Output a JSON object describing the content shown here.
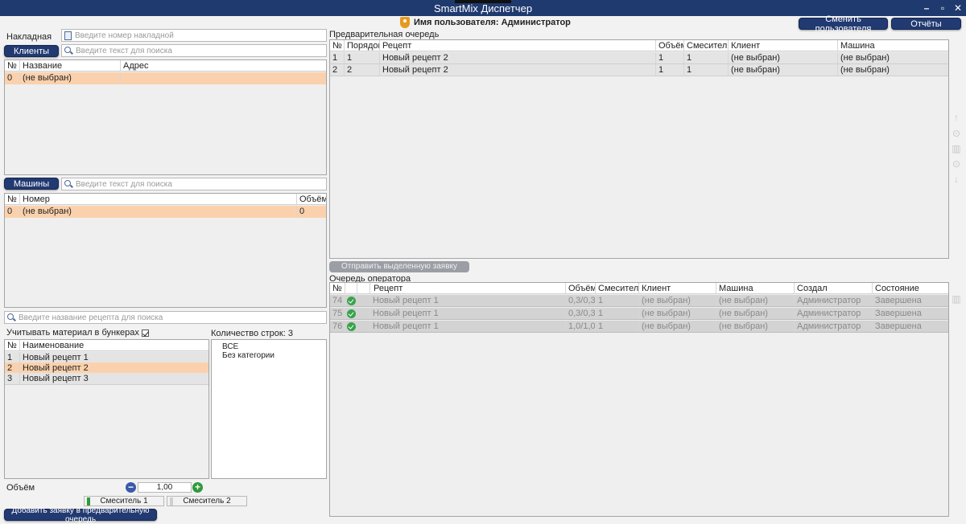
{
  "app": {
    "title": "SmartMix Диспетчер",
    "user_line": "Имя пользователя: Администратор",
    "change_user_label": "Сменить пользователя",
    "reports_label": "Отчёты"
  },
  "invoice": {
    "label": "Накладная",
    "placeholder": "Введите номер накладной"
  },
  "clients": {
    "button_label": "Клиенты",
    "placeholder": "Введите текст для поиска",
    "columns": [
      "№",
      "Название",
      "Адрес"
    ],
    "rows": [
      [
        "0",
        "(не выбран)",
        ""
      ]
    ]
  },
  "machines": {
    "button_label": "Машины",
    "placeholder": "Введите текст для поиска",
    "columns": [
      "№",
      "Номер",
      "Объём"
    ],
    "rows": [
      [
        "0",
        "(не выбран)",
        "0"
      ]
    ]
  },
  "recipes": {
    "placeholder": "Введите название рецепта для поиска",
    "bunker_label": "Учитывать материал в бункерах",
    "row_count_label": "Количество строк: 3",
    "columns": [
      "№",
      "Наименование"
    ],
    "rows": [
      [
        "1",
        "Новый рецепт 1"
      ],
      [
        "2",
        "Новый рецепт 2"
      ],
      [
        "3",
        "Новый рецепт 3"
      ]
    ],
    "categories": [
      "ВСЕ",
      "Без категории"
    ]
  },
  "volume": {
    "label": "Объём",
    "value": "1,00"
  },
  "mixers": [
    "Смеситель 1",
    "Смеситель 2"
  ],
  "add_request_label": "Добавить заявку в предварительную очередь",
  "prelim": {
    "label": "Предварительная очередь",
    "columns": [
      "№",
      "Порядок",
      "Рецепт",
      "Объём",
      "Смеситель",
      "Клиент",
      "Машина"
    ],
    "rows": [
      [
        "1",
        "1",
        "Новый рецепт 2",
        "1",
        "1",
        "(не выбран)",
        "(не выбран)"
      ],
      [
        "2",
        "2",
        "Новый рецепт 2",
        "1",
        "1",
        "(не выбран)",
        "(не выбран)"
      ]
    ]
  },
  "send_label": "Отправить выделенную заявку оператору",
  "operator": {
    "label": "Очередь оператора",
    "columns": [
      "№",
      "",
      "Рецепт",
      "Объём",
      "Смеситель",
      "Клиент",
      "Машина",
      "Создал",
      "Состояние"
    ],
    "rows": [
      [
        "74",
        "",
        "Новый рецепт 1",
        "0,3/0,3",
        "1",
        "(не выбран)",
        "(не выбран)",
        "Администратор",
        "Завершена"
      ],
      [
        "75",
        "",
        "Новый рецепт 1",
        "0,3/0,3",
        "1",
        "(не выбран)",
        "(не выбран)",
        "Администратор",
        "Завершена"
      ],
      [
        "76",
        "",
        "Новый рецепт 1",
        "1,0/1,0",
        "1",
        "(не выбран)",
        "(не выбран)",
        "Администратор",
        "Завершена"
      ]
    ]
  },
  "colors": {
    "titlebar": "#1f3a6e",
    "button": "#223a72",
    "selected_row": "#fbd1ad",
    "ok_icon": "#37a34b"
  }
}
